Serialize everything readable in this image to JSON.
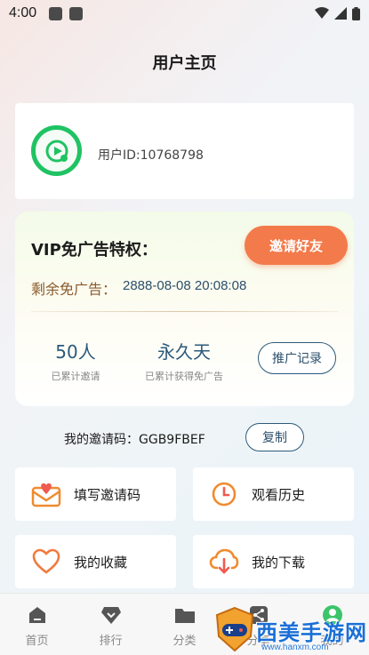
{
  "status_bar": {
    "time": "4:00"
  },
  "header": {
    "title": "用户主页"
  },
  "user": {
    "id_text": "用户ID:10768798"
  },
  "vip": {
    "title": "VIP免广告特权：",
    "invite_button": "邀请好友",
    "remaining_label": "剩余免广告：",
    "remaining_value": "2888-08-08 20:08:08",
    "stats": [
      {
        "value": "50人",
        "label": "已累计邀请"
      },
      {
        "value": "永久天",
        "label": "已累计获得免广告"
      }
    ],
    "promo_button": "推广记录"
  },
  "invite_code": {
    "text": "我的邀请码：GGB9FBEF",
    "copy_button": "复制"
  },
  "menu": [
    {
      "label": "填写邀请码",
      "icon": "envelope-heart-icon"
    },
    {
      "label": "观看历史",
      "icon": "clock-icon"
    },
    {
      "label": "我的收藏",
      "icon": "heart-icon"
    },
    {
      "label": "我的下载",
      "icon": "cloud-download-icon"
    }
  ],
  "tabs": [
    {
      "label": "首页",
      "icon": "home-icon"
    },
    {
      "label": "排行",
      "icon": "rank-icon"
    },
    {
      "label": "分类",
      "icon": "folder-icon"
    },
    {
      "label": "分享",
      "icon": "share-icon"
    },
    {
      "label": "我的",
      "icon": "user-icon"
    }
  ],
  "watermark": {
    "text": "西美手游网",
    "url": "www.hanxm.com"
  },
  "colors": {
    "accent": "#f37a4a",
    "primary_text": "#2c5a7a",
    "avatar_ring": "#1fc363"
  }
}
